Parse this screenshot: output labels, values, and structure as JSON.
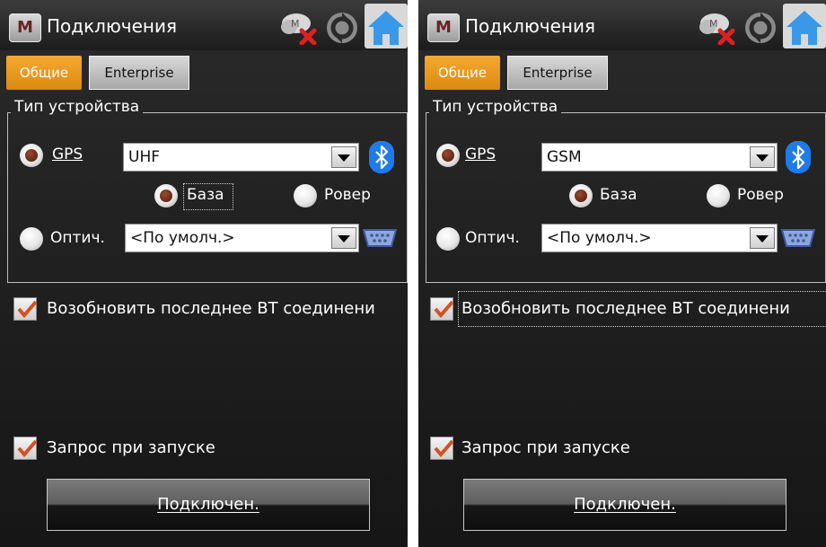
{
  "screens": [
    {
      "title": "Подключения",
      "logo_letter": "M",
      "tabs": {
        "general": "Общие",
        "enterprise": "Enterprise"
      },
      "device_type_label": "Тип устройства",
      "gps_label": "GPS",
      "gps_selected": true,
      "gps_combo_value": "UHF",
      "base_label": "База",
      "base_selected": true,
      "rover_label": "Ровер",
      "optic_label": "Оптич.",
      "optic_combo_value": "<По умолч.>",
      "resume_bt_label": "Возобновить последнее BT соединени",
      "resume_bt_checked": true,
      "ask_on_start_label": "Запрос при запуске",
      "ask_on_start_checked": true,
      "connect_button_label": "Подключен."
    },
    {
      "title": "Подключения",
      "logo_letter": "M",
      "tabs": {
        "general": "Общие",
        "enterprise": "Enterprise"
      },
      "device_type_label": "Тип устройства",
      "gps_label": "GPS",
      "gps_selected": true,
      "gps_combo_value": "GSM",
      "base_label": "База",
      "base_selected": true,
      "rover_label": "Ровер",
      "optic_label": "Оптич.",
      "optic_combo_value": "<По умолч.>",
      "resume_bt_label": "Возобновить последнее BT соединени",
      "resume_bt_checked": true,
      "ask_on_start_label": "Запрос при запуске",
      "ask_on_start_checked": true,
      "connect_button_label": "Подключен."
    }
  ],
  "icons": {
    "logo": "app-logo-icon",
    "cloud": "cloud-disconnected-icon",
    "sync": "sync-icon",
    "home": "home-icon",
    "bluetooth": "bluetooth-icon",
    "serial": "serial-port-icon",
    "check": "checkmark-icon"
  },
  "colors": {
    "accent_tab": "#f29a1c",
    "home": "#3a98e8",
    "bluetooth": "#1f7be8",
    "check": "#d4511e",
    "radio_dot": "#7a2c14"
  }
}
